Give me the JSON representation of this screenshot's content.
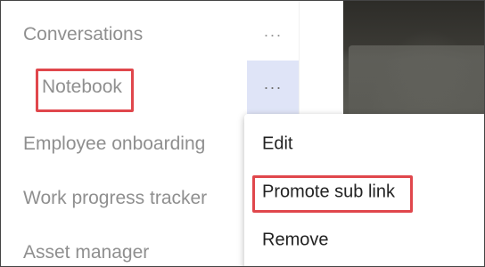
{
  "nav": {
    "items": [
      {
        "label": "Conversations"
      },
      {
        "label": "Notebook"
      },
      {
        "label": "Employee onboarding"
      },
      {
        "label": "Work progress tracker"
      },
      {
        "label": "Asset manager"
      }
    ],
    "more_glyph": "···"
  },
  "menu": {
    "items": [
      {
        "label": "Edit"
      },
      {
        "label": "Promote sub link"
      },
      {
        "label": "Remove"
      }
    ]
  },
  "colors": {
    "highlight": "#e0474c",
    "active_more_bg": "#dfe4f7"
  }
}
